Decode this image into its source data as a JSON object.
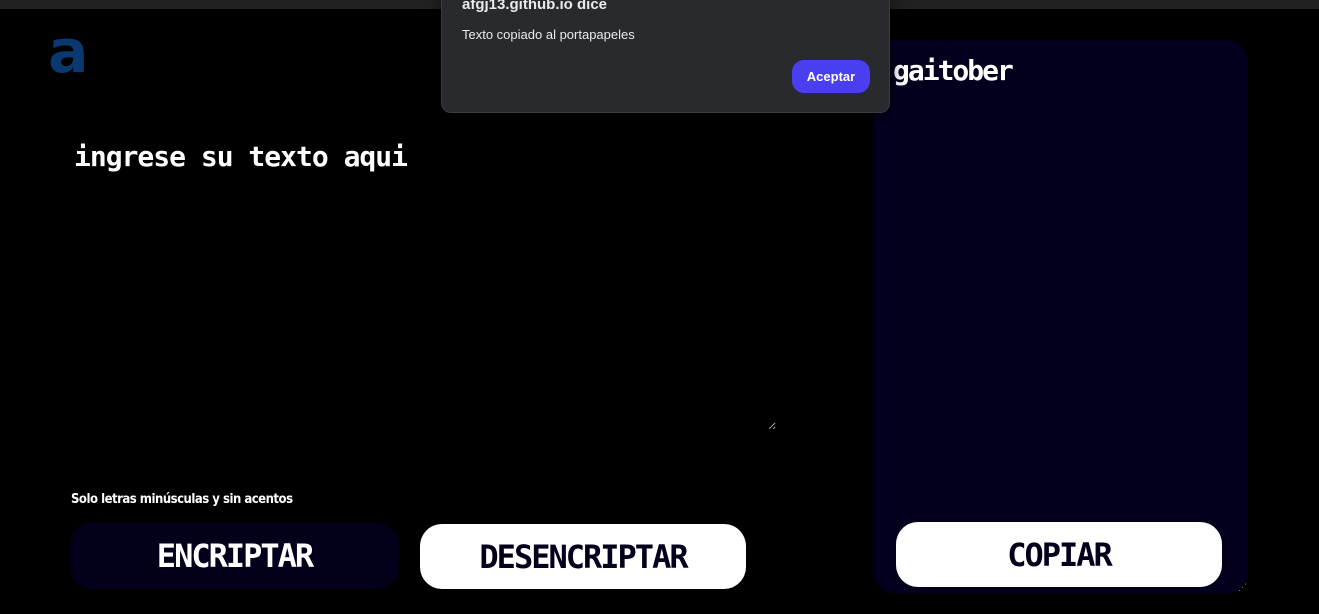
{
  "logo": {
    "glyph": "a",
    "color": "#0a3871"
  },
  "input": {
    "placeholder": "ingrese su texto aqui",
    "value": ""
  },
  "hint": {
    "text": "Solo letras minúsculas y sin acentos"
  },
  "buttons": {
    "encrypt_label": "ENCRIPTAR",
    "decrypt_label": "DESENCRIPTAR",
    "copy_label": "COPIAR"
  },
  "output": {
    "text": "gaitober"
  },
  "dialog": {
    "title": "afgj13.github.io dice",
    "message": "Texto copiado al portapapeles",
    "accept_label": "Aceptar"
  },
  "colors": {
    "background": "#000000",
    "panel": "#03001e",
    "accent_button": "#4a3ff0",
    "dark_button": "#03001c"
  }
}
